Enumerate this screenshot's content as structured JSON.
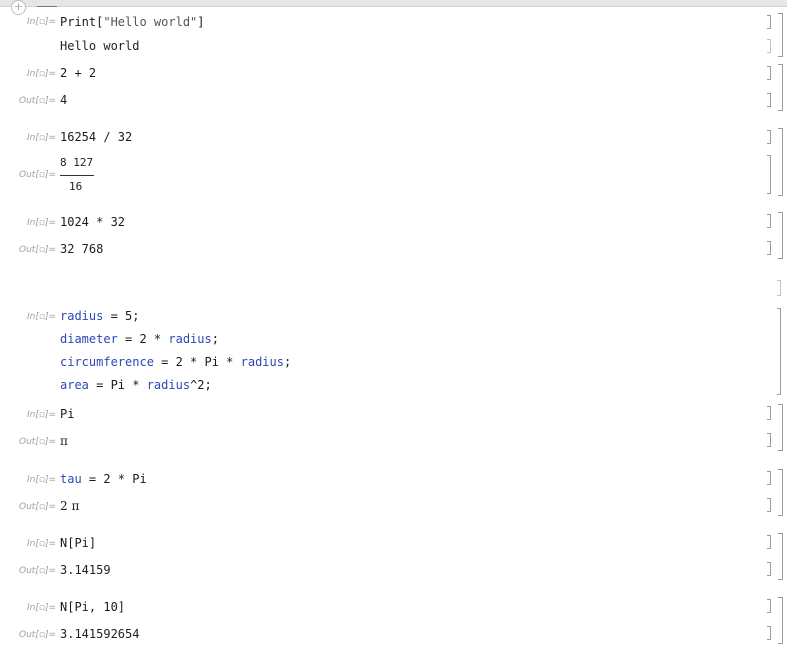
{
  "cells": {
    "c1": {
      "in_label": "In[▫]=",
      "code_fn": "Print[",
      "code_str": "\"Hello world\"",
      "code_close": "]",
      "output": "Hello world"
    },
    "c2": {
      "in_label": "In[▫]=",
      "input": "2 + 2",
      "out_label": "Out[▫]=",
      "output": "4"
    },
    "c3": {
      "in_label": "In[▫]=",
      "input": "16254 / 32",
      "out_label": "Out[▫]=",
      "numerator": "8 127",
      "denominator": "16"
    },
    "c4": {
      "in_label": "In[▫]=",
      "input": "1024 * 32",
      "out_label": "Out[▫]=",
      "output": "32 768"
    },
    "c5": {
      "in_label": "In[▫]=",
      "line1": {
        "var": "radius",
        "rest": " = 5;"
      },
      "line2": {
        "var": "diameter",
        "mid": " = 2 * ",
        "var2": "radius",
        "end": ";"
      },
      "line3": {
        "var": "circumference",
        "mid": " = 2 * Pi * ",
        "var2": "radius",
        "end": ";"
      },
      "line4": {
        "var": "area",
        "mid": " = Pi * ",
        "var2": "radius",
        "end": "^2;"
      }
    },
    "c6": {
      "in_label": "In[▫]=",
      "input": "Pi",
      "out_label": "Out[▫]=",
      "output": "π"
    },
    "c7": {
      "in_label": "In[▫]=",
      "var": "tau",
      "rest": " = 2 * Pi",
      "out_label": "Out[▫]=",
      "output": "2 π"
    },
    "c8": {
      "in_label": "In[▫]=",
      "input": "N[Pi]",
      "out_label": "Out[▫]=",
      "output": "3.14159"
    },
    "c9": {
      "in_label": "In[▫]=",
      "input": "N[Pi, 10]",
      "out_label": "Out[▫]=",
      "output": "3.141592654"
    }
  },
  "icons": {
    "add_cell": "plus-icon",
    "add_cell_glyph": "+"
  },
  "colors": {
    "variable": "#2c48b8",
    "label": "#a0a0a0",
    "bracket": "#9c9c9c"
  }
}
